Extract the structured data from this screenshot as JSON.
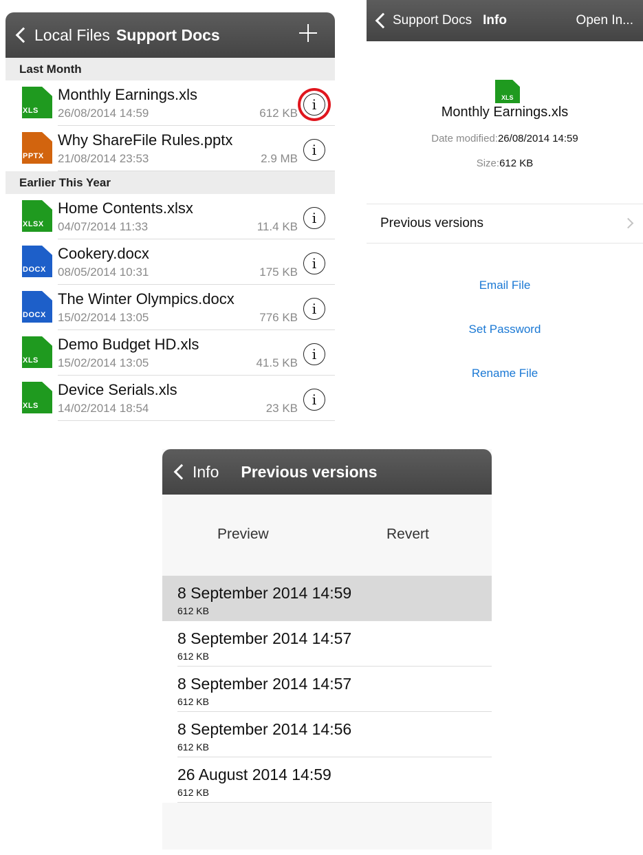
{
  "files_panel": {
    "back_label": "Local Files",
    "title": "Support Docs",
    "add_icon": "plus-icon",
    "sections": [
      {
        "header": "Last Month",
        "files": [
          {
            "name": "Monthly Earnings.xls",
            "date": "26/08/2014 14:59",
            "size": "612 KB",
            "ext": "XLS",
            "color": "#1f9a1f",
            "info_highlighted": true
          },
          {
            "name": "Why ShareFile Rules.pptx",
            "date": "21/08/2014 23:53",
            "size": "2.9 MB",
            "ext": "PPTX",
            "color": "#d2640e"
          }
        ]
      },
      {
        "header": "Earlier This Year",
        "files": [
          {
            "name": "Home Contents.xlsx",
            "date": "04/07/2014 11:33",
            "size": "11.4 KB",
            "ext": "XLSX",
            "color": "#1f9a1f"
          },
          {
            "name": "Cookery.docx",
            "date": "08/05/2014 10:31",
            "size": "175 KB",
            "ext": "DOCX",
            "color": "#1d5fc9"
          },
          {
            "name": "The Winter Olympics.docx",
            "date": "15/02/2014 13:05",
            "size": "776 KB",
            "ext": "DOCX",
            "color": "#1d5fc9"
          },
          {
            "name": "Demo Budget HD.xls",
            "date": "15/02/2014 13:05",
            "size": "41.5 KB",
            "ext": "XLS",
            "color": "#1f9a1f"
          },
          {
            "name": "Device Serials.xls",
            "date": "14/02/2014 18:54",
            "size": "23 KB",
            "ext": "XLS",
            "color": "#1f9a1f"
          }
        ]
      }
    ],
    "info_glyph": "i",
    "highlight_color": "#e0161e"
  },
  "info_panel": {
    "back_label": "Support Docs",
    "title": "Info",
    "open_in_label": "Open In...",
    "file_ext": "XLS",
    "file_name": "Monthly Earnings.xls",
    "date_label": "Date modified:",
    "date_value": "26/08/2014 14:59",
    "size_label": "Size:",
    "size_value": "612 KB",
    "previous_versions_label": "Previous versions",
    "actions": [
      "Email File",
      "Set Password",
      "Rename File"
    ],
    "link_color": "#1a78d4"
  },
  "versions_panel": {
    "back_label": "Info",
    "title": "Previous versions",
    "preview_label": "Preview",
    "revert_label": "Revert",
    "versions": [
      {
        "date": "8 September 2014 14:59",
        "size": "612 KB",
        "selected": true
      },
      {
        "date": "8 September 2014 14:57",
        "size": "612 KB"
      },
      {
        "date": "8 September 2014 14:57",
        "size": "612 KB"
      },
      {
        "date": "8 September 2014 14:56",
        "size": "612 KB"
      },
      {
        "date": "26 August 2014 14:59",
        "size": "612 KB"
      }
    ]
  }
}
